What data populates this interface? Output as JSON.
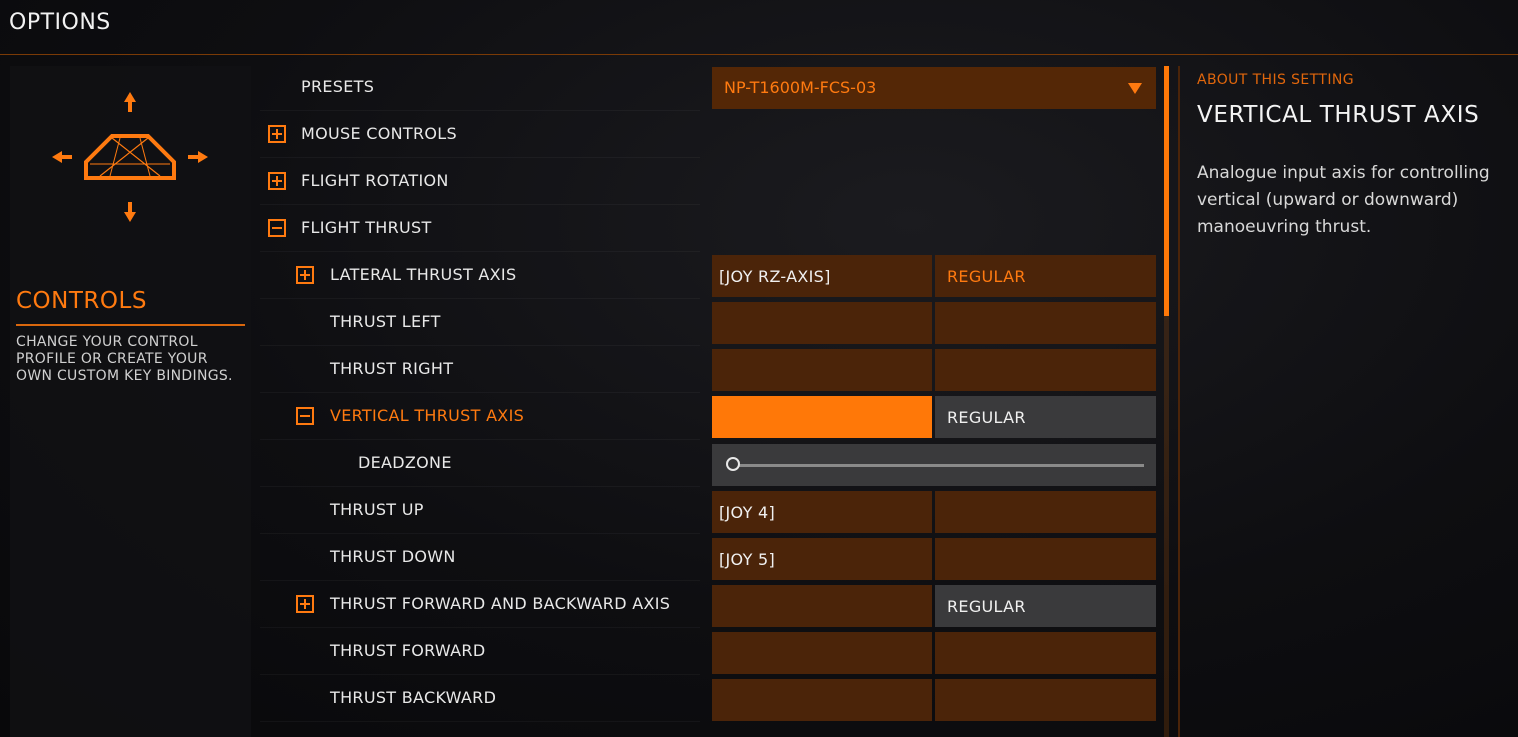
{
  "header": {
    "title": "OPTIONS"
  },
  "left": {
    "title": "CONTROLS",
    "description": "CHANGE YOUR CONTROL PROFILE OR CREATE YOUR OWN CUSTOM KEY BINDINGS."
  },
  "preset": {
    "label": "PRESETS",
    "value": "NP-T1600M-FCS-03"
  },
  "rows": [
    {
      "label": "MOUSE CONTROLS"
    },
    {
      "label": "FLIGHT ROTATION"
    },
    {
      "label": "FLIGHT THRUST"
    },
    {
      "label": "LATERAL THRUST AXIS",
      "binding": "[JOY RZ-AXIS]",
      "mode": "REGULAR"
    },
    {
      "label": "THRUST LEFT"
    },
    {
      "label": "THRUST RIGHT"
    },
    {
      "label": "VERTICAL THRUST AXIS",
      "mode": "REGULAR"
    },
    {
      "label": "DEADZONE"
    },
    {
      "label": "THRUST UP",
      "binding": "[JOY 4]"
    },
    {
      "label": "THRUST DOWN",
      "binding": "[JOY 5]"
    },
    {
      "label": "THRUST FORWARD AND BACKWARD AXIS",
      "mode": "REGULAR"
    },
    {
      "label": "THRUST FORWARD"
    },
    {
      "label": "THRUST BACKWARD"
    }
  ],
  "about": {
    "kicker": "ABOUT THIS SETTING",
    "title": "VERTICAL THRUST AXIS",
    "description": "Analogue input axis for controlling vertical (upward or downward) manoeuvring thrust."
  },
  "colors": {
    "accent": "#ff7808",
    "cell": "#4b2409",
    "cell_neutral": "#3a3a3c"
  },
  "icons": [
    "ship-icon",
    "arrow-up-icon",
    "arrow-down-icon",
    "arrow-left-icon",
    "arrow-right-icon",
    "expand-icon",
    "collapse-icon",
    "dropdown-arrow-icon"
  ],
  "deadzone_value": 0
}
